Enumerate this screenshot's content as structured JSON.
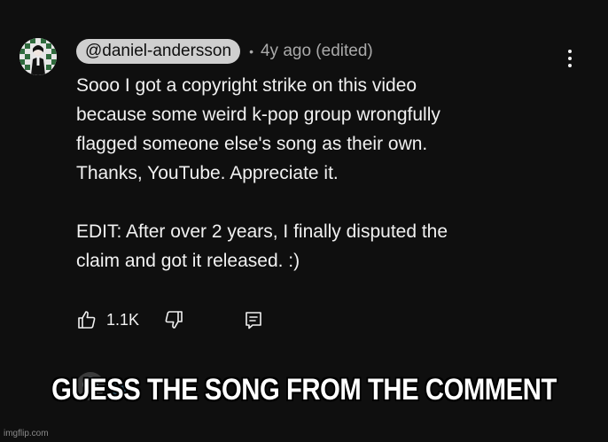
{
  "comment": {
    "avatar_icon": "profile-avatar",
    "author_handle": "@daniel-andersson",
    "separator": "•",
    "meta": "4y ago (edited)",
    "lines": [
      "Sooo I got a copyright strike on this video",
      "because some weird k-pop group wrongfully",
      "flagged someone else's song as their own.",
      "Thanks, YouTube. Appreciate it.",
      "",
      "EDIT: After over 2 years, I finally disputed the",
      "claim and got it released. :)"
    ],
    "like_count": "1.1K",
    "actions": {
      "like_icon": "thumbs-up-icon",
      "dislike_icon": "thumbs-down-icon",
      "reply_icon": "reply-comment-icon",
      "more_icon": "more-vertical-icon"
    }
  },
  "overlay": {
    "caption": "GUESS THE SONG FROM THE COMMENT",
    "watermark": "imgflip.com"
  },
  "colors": {
    "background": "#0f0f0f",
    "text": "#f1f1f1",
    "secondary_text": "#aaaaaa",
    "handle_pill": "#cfcfcf"
  }
}
